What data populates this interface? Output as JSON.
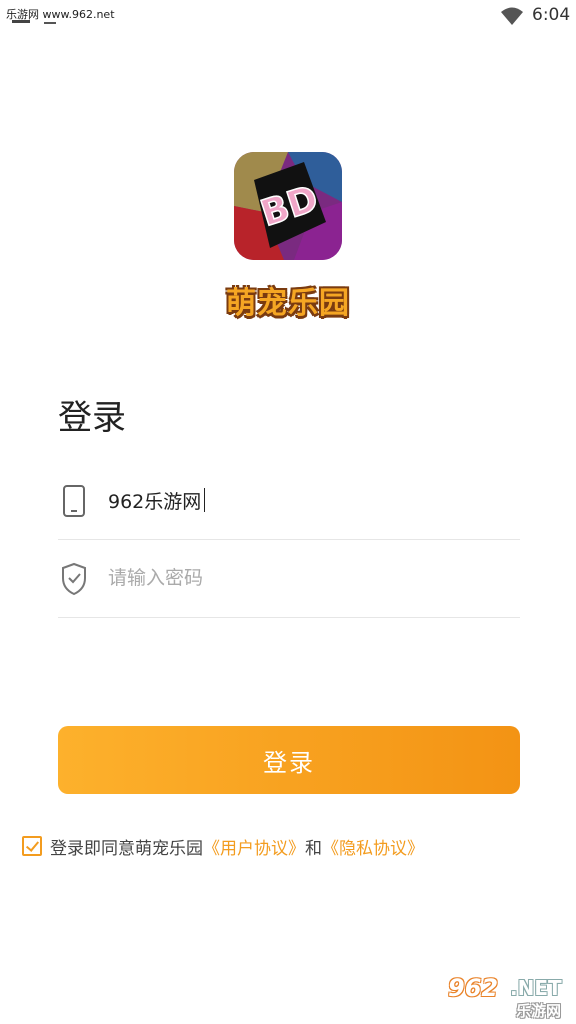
{
  "status_bar": {
    "watermark_text": "乐游网 www.962.net",
    "time": "6:04"
  },
  "logo": {
    "badge_text": "BD",
    "app_name": "萌宠乐园"
  },
  "login": {
    "title": "登录",
    "phone_value": "962乐游网",
    "password_placeholder": "请输入密码",
    "button_label": "登录"
  },
  "agreement": {
    "prefix": "登录即同意萌宠乐园",
    "user_agreement": "《用户协议》",
    "conjunction": "和",
    "privacy_agreement": "《隐私协议》"
  },
  "watermark": {
    "number": "962",
    "suffix": ".NET",
    "chinese": "乐游网"
  },
  "colors": {
    "accent": "#f39c1f",
    "button_start": "#fdb12c",
    "button_end": "#f39314"
  }
}
